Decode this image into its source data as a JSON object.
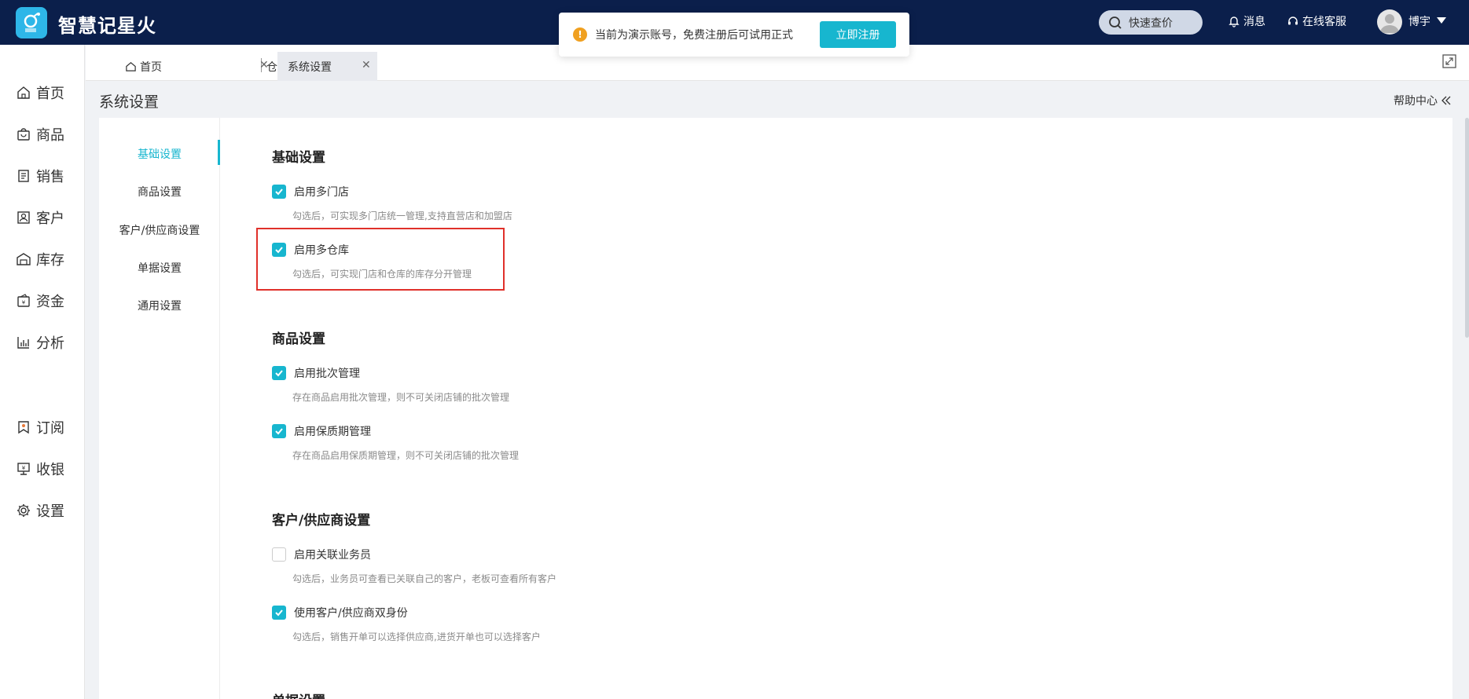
{
  "app": {
    "brand": "智慧记星火",
    "logo_caption": "星火"
  },
  "topbar": {
    "quick_search": "快速查价",
    "messages": "消息",
    "support": "在线客服",
    "user": "博宇"
  },
  "notice": {
    "text": "当前为演示账号，免费注册后可试用正式",
    "button": "立即注册"
  },
  "leftnav": {
    "items": [
      {
        "label": "首页",
        "icon": "home-icon"
      },
      {
        "label": "商品",
        "icon": "bag-icon"
      },
      {
        "label": "销售",
        "icon": "document-icon"
      },
      {
        "label": "客户",
        "icon": "contact-icon"
      },
      {
        "label": "库存",
        "icon": "warehouse-icon"
      },
      {
        "label": "资金",
        "icon": "wallet-icon"
      },
      {
        "label": "分析",
        "icon": "chart-icon"
      },
      {
        "label": "订阅",
        "icon": "bookmark-icon"
      },
      {
        "label": "收银",
        "icon": "cashier-icon"
      },
      {
        "label": "设置",
        "icon": "gear-icon"
      }
    ]
  },
  "tabs": [
    {
      "label": "首页"
    },
    {
      "label": "仓库管理"
    },
    {
      "label": "系统设置",
      "active": true
    }
  ],
  "page": {
    "title": "系统设置",
    "help": "帮助中心"
  },
  "sub_nav": [
    "基础设置",
    "商品设置",
    "客户/供应商设置",
    "单据设置",
    "通用设置"
  ],
  "sections": [
    {
      "title": "基础设置",
      "options": [
        {
          "label": "启用多门店",
          "checked": true,
          "desc": "勾选后，可实现多门店统一管理,支持直营店和加盟店"
        },
        {
          "label": "启用多仓库",
          "checked": true,
          "desc": "勾选后，可实现门店和仓库的库存分开管理"
        }
      ]
    },
    {
      "title": "商品设置",
      "options": [
        {
          "label": "启用批次管理",
          "checked": true,
          "desc": "存在商品启用批次管理，则不可关闭店铺的批次管理"
        },
        {
          "label": "启用保质期管理",
          "checked": true,
          "desc": "存在商品启用保质期管理，则不可关闭店铺的批次管理"
        }
      ]
    },
    {
      "title": "客户/供应商设置",
      "options": [
        {
          "label": "启用关联业务员",
          "checked": false,
          "desc": "勾选后，业务员可查看已关联自己的客户，老板可查看所有客户"
        },
        {
          "label": "使用客户/供应商双身份",
          "checked": true,
          "desc": "勾选后，销售开单可以选择供应商,进货开单也可以选择客户"
        }
      ]
    },
    {
      "title": "单据设置"
    }
  ],
  "colors": {
    "topbar": "#0b1f4b",
    "accent": "#17b6cf",
    "highlight": "#e0302a"
  }
}
